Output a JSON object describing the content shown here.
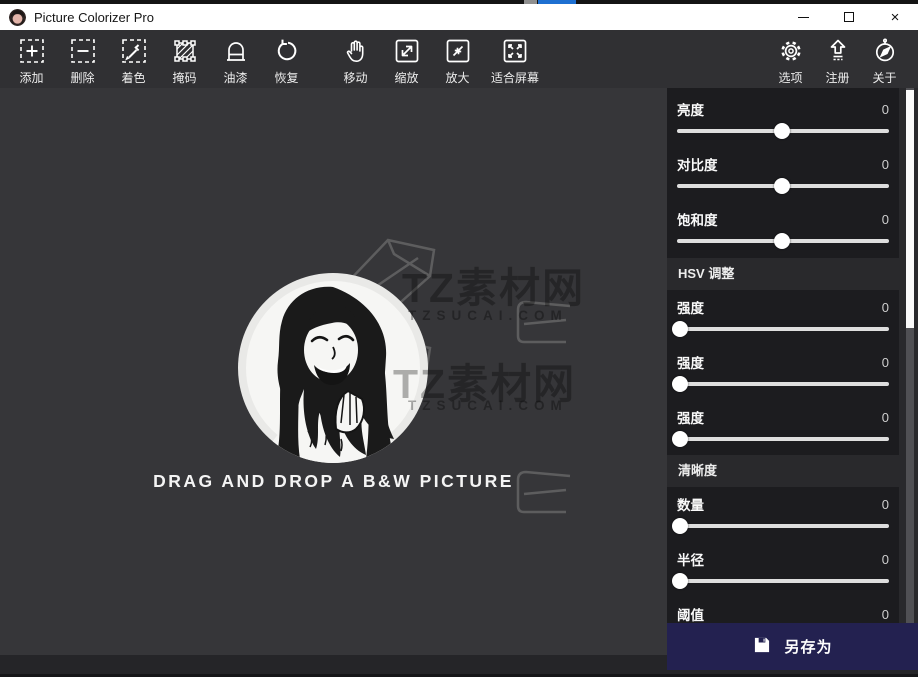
{
  "colors": {
    "titlebar_bg": "#ffffff",
    "toolbar_bg": "#303033",
    "canvas_bg": "#363639",
    "sidebar_panel_bg": "#1c1c1f",
    "sidebar_base_bg": "#29292c",
    "slider_track": "#dedede",
    "slider_thumb": "#ffffff",
    "save_button_bg": "#232150",
    "top_strip_accent": "#1d6fd1"
  },
  "window": {
    "title": "Picture Colorizer Pro",
    "controls": [
      "minimize",
      "maximize",
      "close"
    ],
    "close_glyph": "×"
  },
  "toolbar": {
    "items": [
      {
        "name": "add",
        "icon": "add-icon",
        "label": "添加"
      },
      {
        "name": "delete",
        "icon": "delete-icon",
        "label": "删除"
      },
      {
        "name": "colorize",
        "icon": "eyedropper-icon",
        "label": "着色"
      },
      {
        "name": "mask",
        "icon": "mask-icon",
        "label": "掩码"
      },
      {
        "name": "paint",
        "icon": "paint-icon",
        "label": "油漆"
      },
      {
        "name": "restore",
        "icon": "undo-icon",
        "label": "恢复"
      },
      {
        "name": "move",
        "icon": "hand-icon",
        "label": "移动"
      },
      {
        "name": "zoom",
        "icon": "scale-expand-icon",
        "label": "缩放"
      },
      {
        "name": "enlarge",
        "icon": "scale-collapse-icon",
        "label": "放大"
      },
      {
        "name": "fit-screen",
        "icon": "fit-screen-icon",
        "label": "适合屏幕"
      }
    ],
    "right_items": [
      {
        "name": "options",
        "icon": "gear-icon",
        "label": "选项"
      },
      {
        "name": "register",
        "icon": "register-icon",
        "label": "注册"
      },
      {
        "name": "about",
        "icon": "compass-icon",
        "label": "关于"
      }
    ]
  },
  "canvas": {
    "drop_text": "DRAG AND DROP A B&W PICTURE",
    "watermark": {
      "title": "TZ素材网",
      "domain": "TZSUCAI.COM"
    }
  },
  "sidebar": {
    "sections": [
      {
        "header": "",
        "sliders": [
          {
            "label": "亮度",
            "value": "0",
            "pos": 49.5
          },
          {
            "label": "对比度",
            "value": "0",
            "pos": 49.5
          },
          {
            "label": "饱和度",
            "value": "0",
            "pos": 49.5
          }
        ]
      },
      {
        "header": "HSV 调整",
        "sliders": [
          {
            "label": "强度",
            "value": "0",
            "pos": 1.5
          },
          {
            "label": "强度",
            "value": "0",
            "pos": 1.5
          },
          {
            "label": "强度",
            "value": "0",
            "pos": 1.5
          }
        ]
      },
      {
        "header": "清晰度",
        "sliders": [
          {
            "label": "数量",
            "value": "0",
            "pos": 1.5
          },
          {
            "label": "半径",
            "value": "0",
            "pos": 1.5
          },
          {
            "label": "阈值",
            "value": "0",
            "pos": 1.5
          }
        ]
      }
    ],
    "save_button": {
      "label": "另存为",
      "icon": "save-floppy-icon"
    }
  }
}
